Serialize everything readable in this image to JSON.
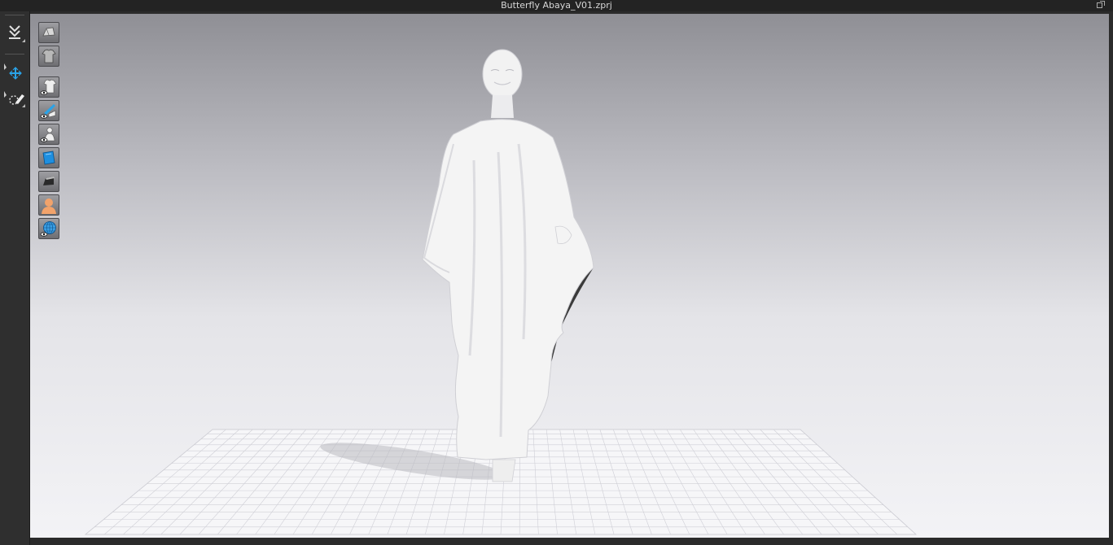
{
  "window": {
    "title": "Butterfly Abaya_V01.zprj"
  },
  "left_toolbar": {
    "items": [
      {
        "name": "simulation-dropdown",
        "icon": "simulate-icon"
      },
      {
        "name": "transform-pattern",
        "icon": "move-cross-icon",
        "active": true
      },
      {
        "name": "edit-pattern",
        "icon": "edit-pattern-icon"
      }
    ]
  },
  "viewport_toolbar": {
    "items": [
      {
        "name": "show-3d-garment",
        "icon": "garment-solid-icon"
      },
      {
        "name": "show-texture",
        "icon": "tshirt-icon"
      },
      {
        "name": "show-garment-toggle",
        "icon": "garment-eye-icon"
      },
      {
        "name": "show-pattern-toggle",
        "icon": "pattern-eye-icon"
      },
      {
        "name": "show-avatar-toggle",
        "icon": "avatar-eye-icon"
      },
      {
        "name": "show-fabric-toggle",
        "icon": "fabric-blue-icon"
      },
      {
        "name": "show-thick-toggle",
        "icon": "thickness-icon"
      },
      {
        "name": "avatar-skin-toggle",
        "icon": "avatar-skin-icon"
      },
      {
        "name": "environment-toggle",
        "icon": "globe-eye-icon"
      }
    ]
  },
  "colors": {
    "accent": "#2aa3e8",
    "viewport_top": "#8f8f95",
    "viewport_bottom": "#f3f3f6",
    "garment": "#f4f4f4",
    "garment_lining": "#3a3a3a",
    "skin_icon": "#f2a36b"
  }
}
